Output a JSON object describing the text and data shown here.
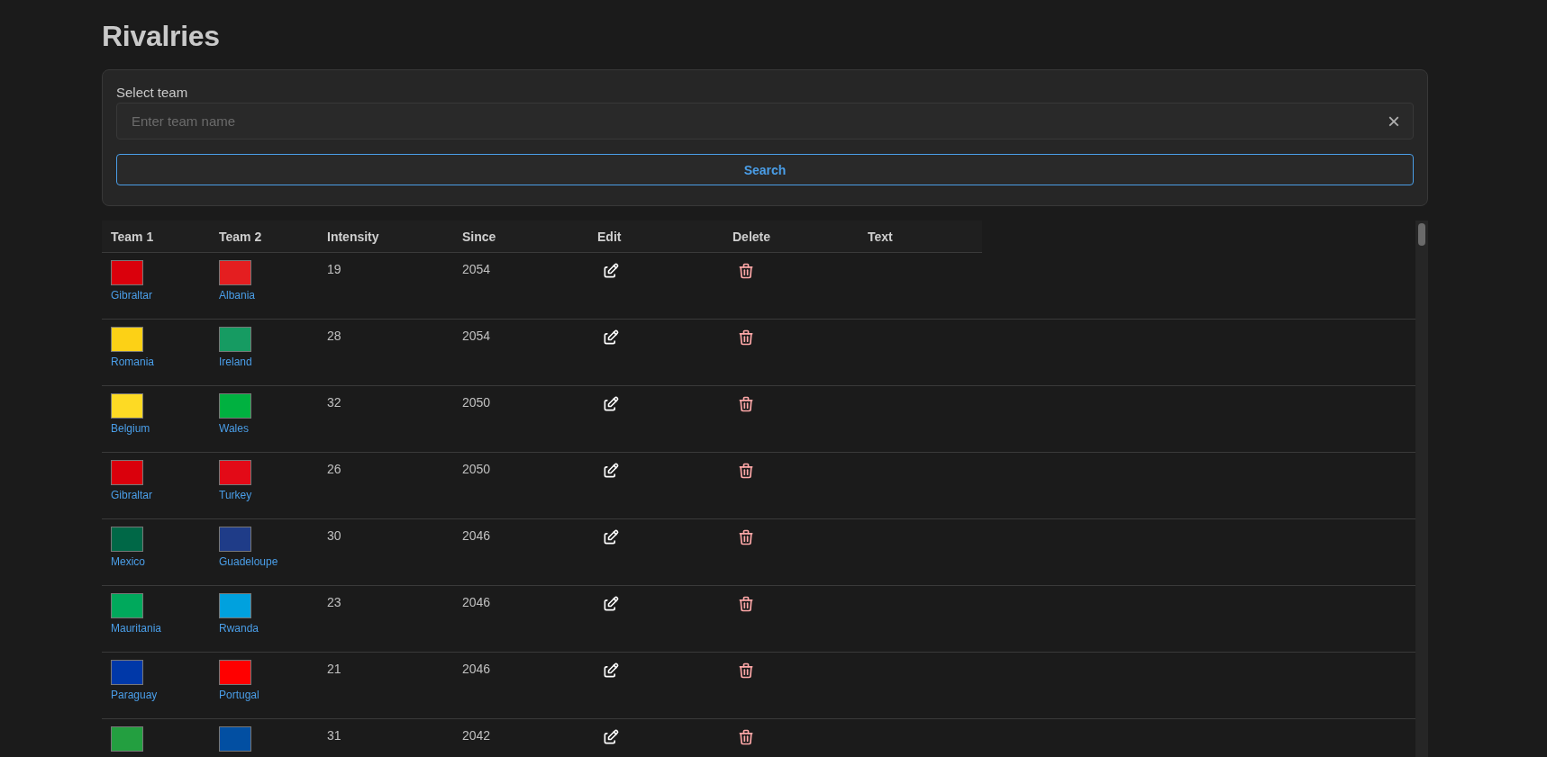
{
  "title": "Rivalries",
  "filter": {
    "label": "Select team",
    "placeholder": "Enter team name",
    "clear": "×",
    "button": "Search"
  },
  "table": {
    "columns": [
      "Team 1",
      "Team 2",
      "Intensity",
      "Since",
      "Edit",
      "Delete",
      "Text"
    ],
    "rows": [
      {
        "team1": {
          "name": "Gibraltar",
          "color": "#da000c"
        },
        "team2": {
          "name": "Albania",
          "color": "#e41e20"
        },
        "intensity": "19",
        "since": "2054"
      },
      {
        "team1": {
          "name": "Romania",
          "color": "#fcd116"
        },
        "team2": {
          "name": "Ireland",
          "color": "#169b62"
        },
        "intensity": "28",
        "since": "2054"
      },
      {
        "team1": {
          "name": "Belgium",
          "color": "#fdda24"
        },
        "team2": {
          "name": "Wales",
          "color": "#00b140"
        },
        "intensity": "32",
        "since": "2050"
      },
      {
        "team1": {
          "name": "Gibraltar",
          "color": "#da000c"
        },
        "team2": {
          "name": "Turkey",
          "color": "#e30a17"
        },
        "intensity": "26",
        "since": "2050"
      },
      {
        "team1": {
          "name": "Mexico",
          "color": "#006847"
        },
        "team2": {
          "name": "Guadeloupe",
          "color": "#1f3c88"
        },
        "intensity": "30",
        "since": "2046"
      },
      {
        "team1": {
          "name": "Mauritania",
          "color": "#00a95c"
        },
        "team2": {
          "name": "Rwanda",
          "color": "#00a1de"
        },
        "intensity": "23",
        "since": "2046"
      },
      {
        "team1": {
          "name": "Paraguay",
          "color": "#0038a8"
        },
        "team2": {
          "name": "Portugal",
          "color": "#ff0000"
        },
        "intensity": "21",
        "since": "2046"
      },
      {
        "team1": {
          "color": "#239f40"
        },
        "team2": {
          "color": "#024fa2"
        },
        "intensity": "31",
        "since": "2042"
      }
    ]
  }
}
